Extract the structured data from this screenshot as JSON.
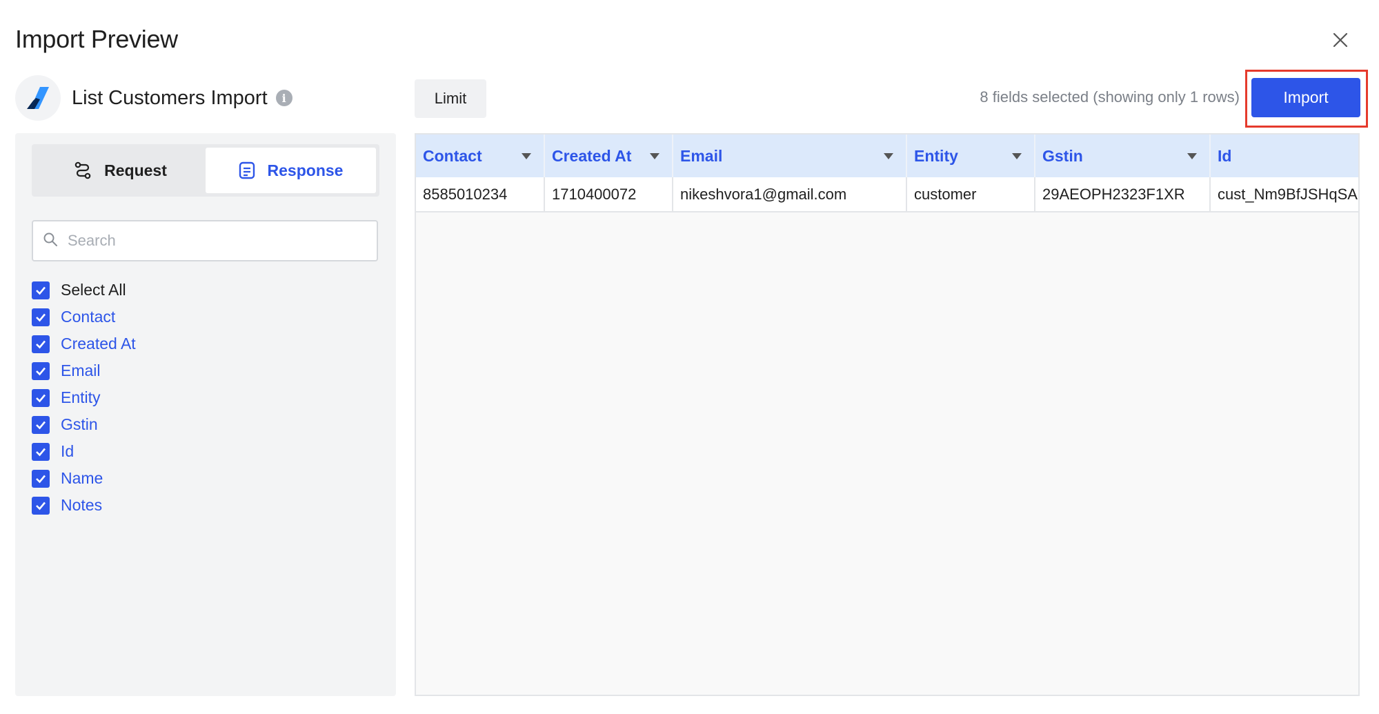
{
  "dialog": {
    "title": "Import Preview"
  },
  "source": {
    "name": "List Customers Import"
  },
  "toggle": {
    "request_label": "Request",
    "response_label": "Response",
    "active": "Response"
  },
  "search": {
    "placeholder": "Search",
    "value": ""
  },
  "fields": {
    "select_all_label": "Select All",
    "select_all_checked": true,
    "items": [
      {
        "label": "Contact",
        "checked": true
      },
      {
        "label": "Created At",
        "checked": true
      },
      {
        "label": "Email",
        "checked": true
      },
      {
        "label": "Entity",
        "checked": true
      },
      {
        "label": "Gstin",
        "checked": true
      },
      {
        "label": "Id",
        "checked": true
      },
      {
        "label": "Name",
        "checked": true
      },
      {
        "label": "Notes",
        "checked": true
      }
    ]
  },
  "toolbar": {
    "limit_label": "Limit",
    "selection_info": "8 fields selected (showing only 1 rows)",
    "import_label": "Import"
  },
  "table": {
    "columns": [
      "Contact",
      "Created At",
      "Email",
      "Entity",
      "Gstin",
      "Id"
    ],
    "rows": [
      [
        "8585010234",
        "1710400072",
        "nikeshvora1@gmail.com",
        "customer",
        "29AEOPH2323F1XR",
        "cust_Nm9BfJSHqSA"
      ]
    ]
  },
  "colors": {
    "accent": "#2d55e8",
    "highlight": "#e53a2c",
    "header_bg": "#dce9fb"
  }
}
